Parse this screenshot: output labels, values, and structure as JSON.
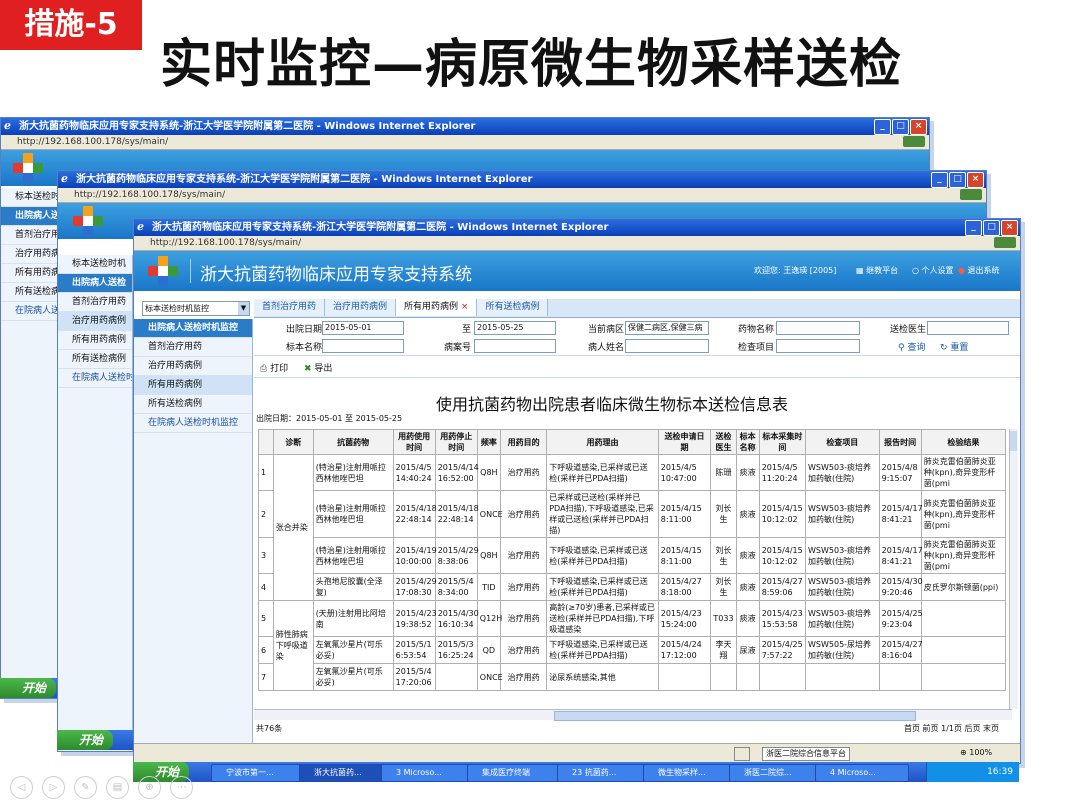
{
  "slide": {
    "badge": "措施-5",
    "title": "实时监控—病原微生物采样送检"
  },
  "window": {
    "title": "浙大抗菌药物临床应用专家支持系统-浙江大学医学院附属第二医院 - Windows Internet Explorer",
    "url": "http://192.168.100.178/sys/main/",
    "url_short": "http://192.168.100.178/sys/main/"
  },
  "app": {
    "name": "浙大抗菌药物临床应用专家支持系统",
    "welcome": "欢迎您: 王逸瑛 [2005]",
    "links": [
      "继教平台",
      "个人设置",
      "退出系统"
    ]
  },
  "left_select": {
    "value": "标本送检时机监控"
  },
  "back_sidebar": {
    "value": "标本送检时机",
    "head": "出院病人送检",
    "items": [
      "首剂治疗用药",
      "治疗用药病例",
      "所有用药病例",
      "所有送检病例"
    ],
    "bottom": "在院病人送检时机"
  },
  "sidebar": {
    "head": "出院病人送检时机监控",
    "items": [
      "首剂治疗用药",
      "治疗用药病例",
      "所有用药病例",
      "所有送检病例"
    ],
    "bottom": "在院病人送检时机监控"
  },
  "tabs": [
    "首剂治疗用药",
    "治疗用药病例",
    "所有用药病例",
    "所有送检病例"
  ],
  "active_tab": "所有用药病例",
  "filters": {
    "discharge_date_label": "出院日期",
    "discharge_from": "2015-05-01",
    "to_label": "至",
    "discharge_to": "2015-05-25",
    "ward_label": "当前病区",
    "ward": "保健二病区,保健三病",
    "drug_label": "药物名称",
    "doctor_label": "送检医生",
    "specimen_label": "标本名称",
    "case_label": "病案号",
    "patient_label": "病人姓名",
    "exam_label": "检查项目",
    "query": "查询",
    "reset": "重置"
  },
  "toolbar": {
    "print": "打印",
    "export": "导出"
  },
  "report": {
    "title": "使用抗菌药物出院患者临床微生物标本送检信息表",
    "date_range": "出院日期：2015-05-01 至 2015-05-25"
  },
  "table": {
    "headers": [
      "",
      "诊断",
      "抗菌药物",
      "用药使用时间",
      "用药停止时间",
      "频率",
      "用药目的",
      "用药理由",
      "送检申请日期",
      "送检医生",
      "标本名称",
      "标本采集时间",
      "检查项目",
      "报告时间",
      "检验结果"
    ],
    "diag_group1": "张合并染",
    "diag_group2": "肺性肺病下呼吸道染",
    "rows": [
      {
        "n": "1",
        "drug": "(特治星)注射用哌拉西林他唑巴坦",
        "start": "2015/4/5 14:40:24",
        "stop": "2015/4/14 16:52:00",
        "freq": "Q8H",
        "purpose": "治疗用药",
        "reason": "下呼吸道感染,已采样或已送检(采样并已PDA扫描)",
        "apply": "2015/4/5 10:47:00",
        "doctor": "陈珊",
        "specimen": "痰液",
        "collect": "2015/4/5 11:20:24",
        "exam": "WSW503-痰培养加药敏(住院)",
        "report": "2015/4/8 9:15:07",
        "result": "肺炎克雷伯菌肺炎亚种(kpn),奇异变形杆菌(pmi"
      },
      {
        "n": "2",
        "drug": "(特治星)注射用哌拉西林他唑巴坦",
        "start": "2015/4/18 22:48:14",
        "stop": "2015/4/18 22:48:14",
        "freq": "ONCE",
        "purpose": "治疗用药",
        "reason": "已采样或已送检(采样并已PDA扫描),下呼吸道感染,已采样或已送检(采样并已PDA扫描)",
        "apply": "2015/4/15 8:11:00",
        "doctor": "刘长生",
        "specimen": "痰液",
        "collect": "2015/4/15 10:12:02",
        "exam": "WSW503-痰培养加药敏(住院)",
        "report": "2015/4/17 8:41:21",
        "result": "肺炎克雷伯菌肺炎亚种(kpn),奇异变形杆菌(pmi"
      },
      {
        "n": "3",
        "drug": "(特治星)注射用哌拉西林他唑巴坦",
        "start": "2015/4/19 10:00:00",
        "stop": "2015/4/29 8:38:06",
        "freq": "Q8H",
        "purpose": "治疗用药",
        "reason": "下呼吸道感染,已采样或已送检(采样并已PDA扫描)",
        "apply": "2015/4/15 8:11:00",
        "doctor": "刘长生",
        "specimen": "痰液",
        "collect": "2015/4/15 10:12:02",
        "exam": "WSW503-痰培养加药敏(住院)",
        "report": "2015/4/17 8:41:21",
        "result": "肺炎克雷伯菌肺炎亚种(kpn),奇异变形杆菌(pmi"
      },
      {
        "n": "4",
        "drug": "头孢地尼胶囊(全泽复)",
        "start": "2015/4/29 17:08:30",
        "stop": "2015/5/4 8:34:00",
        "freq": "TID",
        "purpose": "治疗用药",
        "reason": "下呼吸道感染,已采样或已送检(采样并已PDA扫描)",
        "apply": "2015/4/27 8:18:00",
        "doctor": "刘长生",
        "specimen": "痰液",
        "collect": "2015/4/27 8:59:06",
        "exam": "WSW503-痰培养加药敏(住院)",
        "report": "2015/4/30 9:20:46",
        "result": "皮氏罗尔斯顿菌(ppi)"
      },
      {
        "n": "5",
        "drug": "(天册)注射用比阿培南",
        "start": "2015/4/23 19:38:52",
        "stop": "2015/4/30 16:10:34",
        "freq": "Q12H",
        "purpose": "治疗用药",
        "reason": "高龄(≥70岁)患者,已采样或已送检(采样并已PDA扫描),下呼吸道感染",
        "apply": "2015/4/23 15:24:00",
        "doctor": "T033",
        "specimen": "痰液",
        "collect": "2015/4/23 15:53:58",
        "exam": "WSW503-痰培养加药敏(住院)",
        "report": "2015/4/25 9:23:04",
        "result": ""
      },
      {
        "n": "6",
        "drug": "左氧氟沙星片(可乐必妥)",
        "start": "2015/5/1 6:53:54",
        "stop": "2015/5/3 16:25:24",
        "freq": "QD",
        "purpose": "治疗用药",
        "reason": "下呼吸道感染,已采样或已送检(采样并已PDA扫描)",
        "apply": "2015/4/24 17:12:00",
        "doctor": "李天翔",
        "specimen": "尿液",
        "collect": "2015/4/25 7:57:22",
        "exam": "WSW505-尿培养加药敏(住院)",
        "report": "2015/4/27 8:16:04",
        "result": ""
      },
      {
        "n": "7",
        "drug": "左氧氟沙星片(可乐必妥)",
        "start": "2015/5/4 17:20:06",
        "stop": "",
        "freq": "ONCE",
        "purpose": "治疗用药",
        "reason": "泌尿系统感染,其他",
        "apply": "",
        "doctor": "",
        "specimen": "",
        "collect": "",
        "exam": "",
        "report": "",
        "result": ""
      }
    ],
    "total": "共76条",
    "pager": "首页 前页 1/1页 后页 末页"
  },
  "statusbar": {
    "zone": "浙医二院综合信息平台",
    "zoom": "100%"
  },
  "taskbar": {
    "start": "开始",
    "back_start": "开始",
    "items": [
      "宁波市第一...",
      "浙大抗菌药...",
      "3 Microso...",
      "集成医疗终端",
      "23 抗菌药...",
      "微生物采样...",
      "浙医二院综...",
      "4 Microso..."
    ],
    "clock": "16:39"
  },
  "slide_controls": [
    "◁",
    "▷",
    "✎",
    "▤",
    "⊕",
    "⋯"
  ]
}
